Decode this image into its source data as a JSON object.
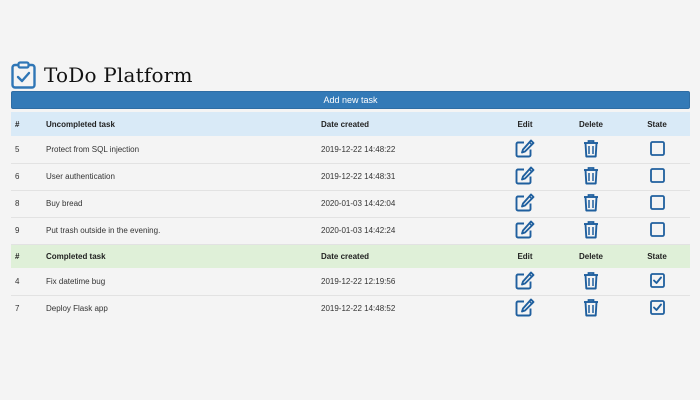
{
  "app": {
    "title": "ToDo Platform"
  },
  "toolbar": {
    "add_label": "Add new task"
  },
  "colors": {
    "accent": "#337ab7",
    "uncompleted_header": "#d9eaf7",
    "completed_header": "#dff0d8",
    "icon": "#1f5f9e"
  },
  "uncompleted": {
    "headers": {
      "num": "#",
      "task": "Uncompleted task",
      "date": "Date created",
      "edit": "Edit",
      "delete": "Delete",
      "state": "State"
    },
    "rows": [
      {
        "id": "5",
        "task": "Protect from SQL injection",
        "date": "2019-12-22 14:48:22",
        "done": false
      },
      {
        "id": "6",
        "task": "User authentication",
        "date": "2019-12-22 14:48:31",
        "done": false
      },
      {
        "id": "8",
        "task": "Buy bread",
        "date": "2020-01-03 14:42:04",
        "done": false
      },
      {
        "id": "9",
        "task": "Put trash outside in the evening.",
        "date": "2020-01-03 14:42:24",
        "done": false
      }
    ]
  },
  "completed": {
    "headers": {
      "num": "#",
      "task": "Completed task",
      "date": "Date created",
      "edit": "Edit",
      "delete": "Delete",
      "state": "State"
    },
    "rows": [
      {
        "id": "4",
        "task": "Fix datetime bug",
        "date": "2019-12-22 12:19:56",
        "done": true
      },
      {
        "id": "7",
        "task": "Deploy Flask app",
        "date": "2019-12-22 14:48:52",
        "done": true
      }
    ]
  },
  "icons": {
    "logo": "clipboard-check-icon",
    "edit": "edit-icon",
    "delete": "trash-icon",
    "unchecked": "checkbox-empty-icon",
    "checked": "checkbox-checked-icon"
  }
}
